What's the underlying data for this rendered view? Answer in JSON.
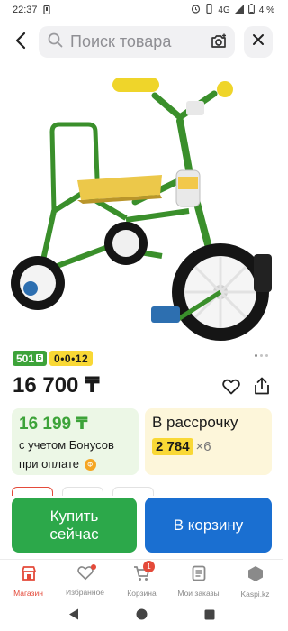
{
  "status_bar": {
    "time": "22:37",
    "network": "4G",
    "battery": "4 %"
  },
  "search": {
    "placeholder": "Поиск товара"
  },
  "icons": {
    "back": "back-arrow-icon",
    "search": "search-icon",
    "camera": "camera-search-icon",
    "close": "close-icon",
    "favorite": "heart-icon",
    "share": "share-icon"
  },
  "product": {
    "image": "green children's tricycle with yellow seat and handles",
    "bonus_badge": "501",
    "bonus_badge_icon": "Б",
    "installment_badge": "0•0•12",
    "price": "16 700 ₸"
  },
  "bonus_card": {
    "amount": "16 199 ₸",
    "line1": "с учетом Бонусов",
    "line2": "при оплате",
    "coin_label": "Ф"
  },
  "installment_card": {
    "title": "В рассрочку",
    "amount": "2 784",
    "multiplier": "×6"
  },
  "actions": {
    "buy_now": "Купить сейчас",
    "add_to_cart": "В корзину"
  },
  "tabbar": {
    "items": [
      {
        "label": "Магазин",
        "icon": "shop-icon",
        "active": true
      },
      {
        "label": "Избранное",
        "icon": "heart-icon"
      },
      {
        "label": "Корзина",
        "icon": "cart-icon",
        "badge": "1"
      },
      {
        "label": "Мои заказы",
        "icon": "orders-icon"
      },
      {
        "label": "Kaspi.kz",
        "icon": "kaspi-icon"
      }
    ]
  },
  "colors": {
    "accent_red": "#e44a3a",
    "buy_green": "#2ca84a",
    "cart_blue": "#1a6fd1",
    "bonus_green": "#3da339",
    "installment_yellow": "#f9d835"
  }
}
